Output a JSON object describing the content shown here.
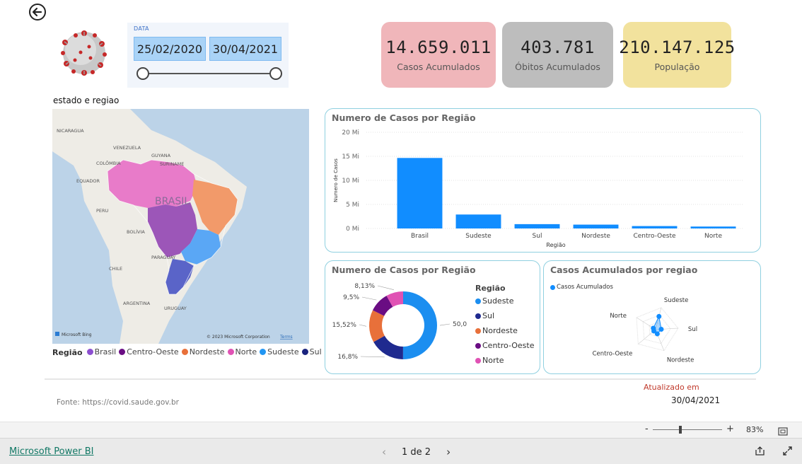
{
  "header": {
    "date_filter": {
      "label": "DATA",
      "start": "25/02/2020",
      "end": "30/04/2021",
      "range_fraction": [
        0,
        1
      ]
    }
  },
  "kpis": [
    {
      "value": "14.659.011",
      "label": "Casos Acumulados",
      "color": "#f0b6ba"
    },
    {
      "value": "403.781",
      "label": "Óbitos Acumulados",
      "color": "#bdbdbd"
    },
    {
      "value": "210.147.125",
      "label": "População",
      "color": "#f2e29d"
    }
  ],
  "map": {
    "title": "estado e regiao",
    "labels": [
      "NICARAGUA",
      "VENEZUELA",
      "SURINAME",
      "GUYANA",
      "COLÔMBIA",
      "EQUADOR",
      "PERU",
      "BRASIL",
      "BOLÍVIA",
      "PARAGUAY",
      "CHILE",
      "URUGUAY",
      "ARGENTINA"
    ],
    "attribution": "© 2023 Microsoft Corporation",
    "terms": "Terms",
    "brand": "Microsoft Bing",
    "legend_title": "Região",
    "legend": [
      {
        "name": "Brasil",
        "color": "#8c4fd0"
      },
      {
        "name": "Centro-Oeste",
        "color": "#6a0d83"
      },
      {
        "name": "Nordeste",
        "color": "#e8703a"
      },
      {
        "name": "Norte",
        "color": "#e052b4"
      },
      {
        "name": "Sudeste",
        "color": "#2196f3"
      },
      {
        "name": "Sul",
        "color": "#1a237e"
      }
    ]
  },
  "bar_card": {
    "title": "Numero de Casos por Região"
  },
  "donut_card": {
    "title": "Numero de Casos por Região",
    "legend_title": "Região"
  },
  "radar_card": {
    "title": "Casos Acumulados por regiao",
    "legend_label": "Casos Acumulados"
  },
  "chart_data": [
    {
      "type": "bar",
      "title": "Numero de Casos por Região",
      "categories": [
        "Brasil",
        "Sudeste",
        "Sul",
        "Nordeste",
        "Centro-Oeste",
        "Norte"
      ],
      "values": [
        14.66,
        2.9,
        0.9,
        0.8,
        0.5,
        0.4
      ],
      "xlabel": "Região",
      "ylabel": "Numero de Casos",
      "yticks": [
        "0 Mi",
        "5 Mi",
        "10 Mi",
        "15 Mi",
        "20 Mi"
      ],
      "ylim": [
        0,
        20
      ],
      "unit": "Mi",
      "color": "#118dff",
      "grid": true
    },
    {
      "type": "pie",
      "title": "Numero de Casos por Região",
      "categories": [
        "Sudeste",
        "Sul",
        "Nordeste",
        "Centro-Oeste",
        "Norte"
      ],
      "values": [
        50.04,
        16.8,
        15.52,
        9.5,
        8.13
      ],
      "labels": [
        "50,04%",
        "16,8%",
        "15,52%",
        "9,5%",
        "8,13%"
      ],
      "colors": [
        "#1b8ef0",
        "#1f2a8f",
        "#e8703a",
        "#6a0d83",
        "#e052b4"
      ]
    },
    {
      "type": "radar",
      "title": "Casos Acumulados por regiao",
      "categories": [
        "Sudeste",
        "Sul",
        "Nordeste",
        "Centro-Oeste",
        "Norte"
      ],
      "series": [
        {
          "name": "Casos Acumulados",
          "values": [
            0.6,
            0.25,
            0.2,
            0.1,
            0.12
          ]
        }
      ],
      "color": "#118dff"
    }
  ],
  "footer_info": {
    "source": "Fonte: https://covid.saude.gov.br",
    "updated_label": "Atualizado em",
    "updated_date": "30/04/2021"
  },
  "zoom": {
    "minus": "-",
    "plus": "+",
    "level": "83%",
    "fraction": 0.4
  },
  "footer": {
    "link": "Microsoft Power BI",
    "page": "1 de 2"
  }
}
